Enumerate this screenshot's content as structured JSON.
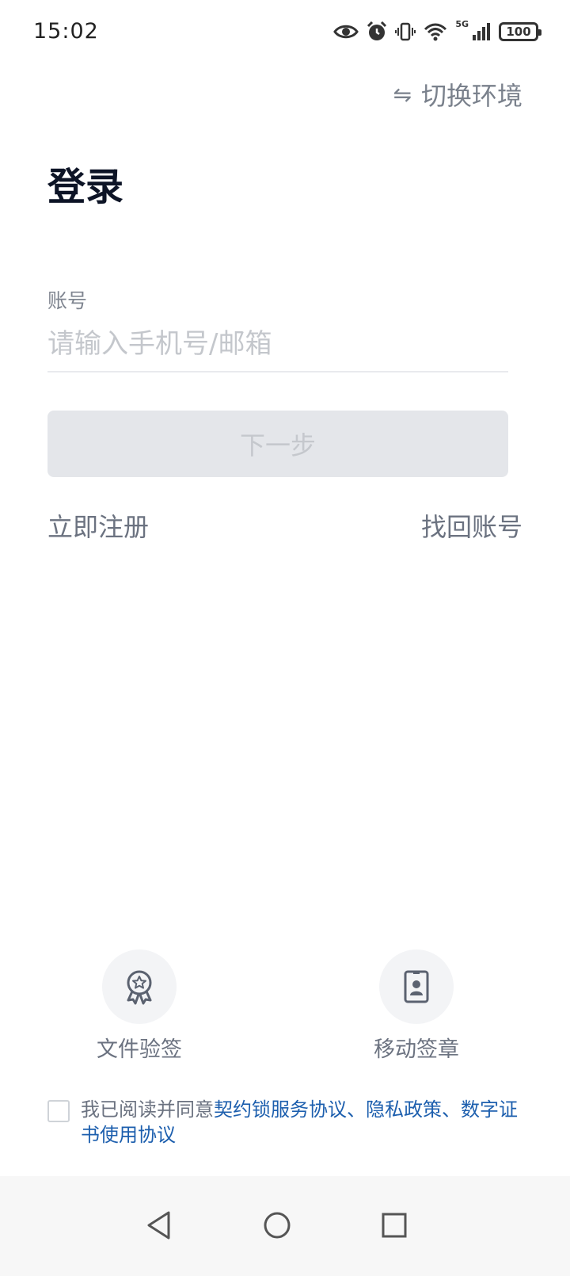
{
  "status_bar": {
    "time": "15:02",
    "network": "5G",
    "battery": "100",
    "icons": [
      "eye-icon",
      "alarm-icon",
      "vibrate-icon",
      "wifi-icon",
      "signal-icon",
      "battery-icon"
    ]
  },
  "header": {
    "switch_env_icon": "⇋",
    "switch_env_label": "切换环境"
  },
  "page": {
    "title": "登录"
  },
  "form": {
    "account_label": "账号",
    "account_value": "",
    "account_placeholder": "请输入手机号/邮箱",
    "next_button": "下一步"
  },
  "links": {
    "register": "立即注册",
    "recover_account": "找回账号"
  },
  "quick_actions": [
    {
      "label": "文件验签",
      "icon": "award-badge-icon"
    },
    {
      "label": "移动签章",
      "icon": "id-card-icon"
    }
  ],
  "agreement": {
    "checked": false,
    "prefix": "我已阅读并同意",
    "link_service": "契约锁服务协议",
    "sep1": "、",
    "link_privacy": "隐私政策",
    "sep2": "、",
    "link_cert": "数字证书使用协议"
  },
  "colors": {
    "title": "#0d1426",
    "secondary_text": "#6b7280",
    "placeholder": "#c4c7cc",
    "button_disabled_bg": "#e4e6ea",
    "button_disabled_text": "#c5c8cd",
    "link": "#1d5fae",
    "nav_bar_bg": "#f7f7f7"
  }
}
